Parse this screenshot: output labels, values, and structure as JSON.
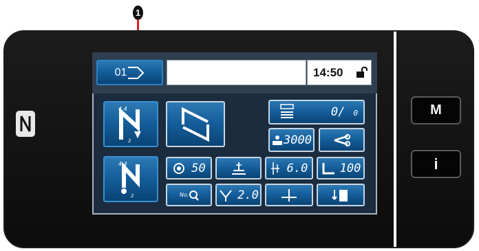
{
  "callout": {
    "label": "1"
  },
  "status": {
    "time": "14:50"
  },
  "pattern_button": {
    "label": "01"
  },
  "counter": {
    "value": "0/",
    "total": "0"
  },
  "speed": {
    "value": "3000"
  },
  "tension": {
    "value": "50"
  },
  "stitch_length": {
    "value": "6.0"
  },
  "presser_pressure": {
    "value": "100"
  },
  "pitch": {
    "value": "2.0"
  },
  "side": {
    "m_label": "M",
    "info_label": "i"
  },
  "icons": [
    "nfc-icon",
    "unlock-icon",
    "sewing-shape-icon",
    "stitch-z-icon",
    "counter-icon",
    "speed-icon",
    "thread-trimmer-icon",
    "tension-icon",
    "presser-foot-icon",
    "stitch-length-icon",
    "presser-pressure-icon",
    "search-icon",
    "pitch-icon",
    "needle-position-icon",
    "stitch-condense-icon"
  ],
  "colors": {
    "bezel": "#111111",
    "screen": "#1a2c3e",
    "button": "#155f9c",
    "callout_line": "#dd2020"
  }
}
